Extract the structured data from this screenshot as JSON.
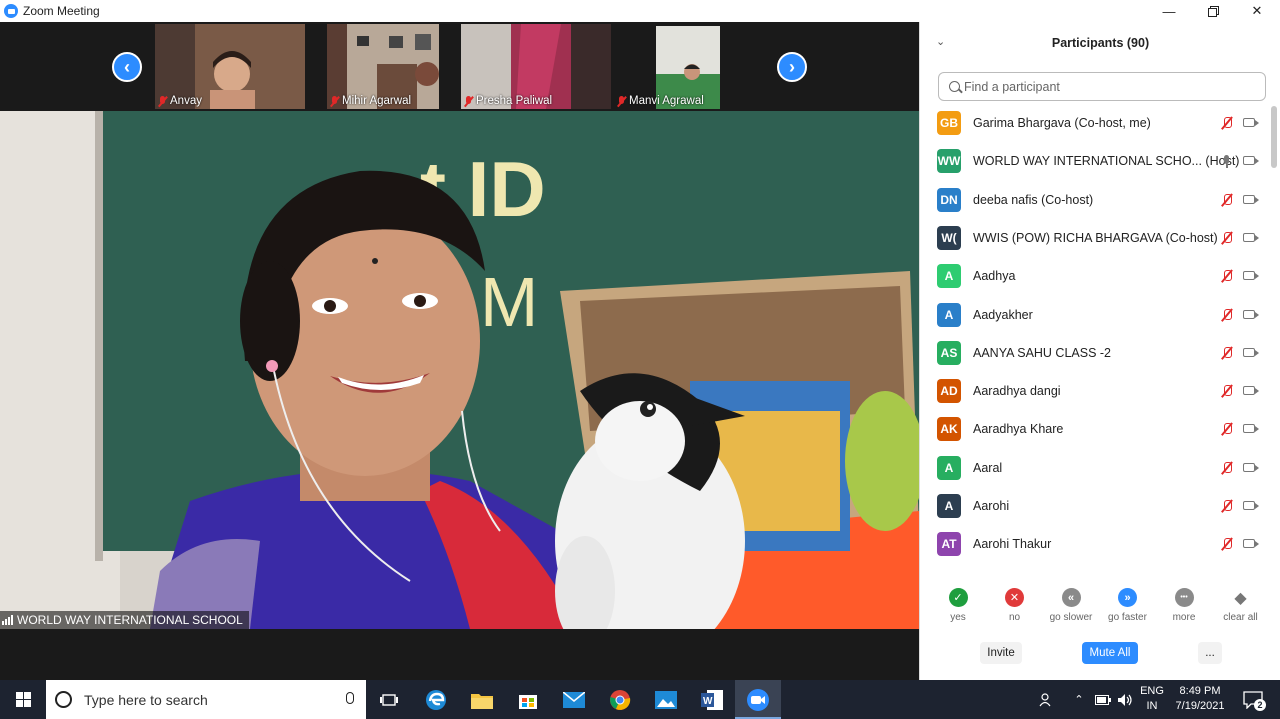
{
  "window": {
    "title": "Zoom Meeting",
    "controls": [
      "minimize",
      "restore",
      "close"
    ]
  },
  "thumbnails": [
    {
      "name": "Anvay",
      "muted": true
    },
    {
      "name": "Mihir Agarwal",
      "muted": true
    },
    {
      "name": "Presha  Paliwal",
      "muted": true
    },
    {
      "name": "Manvi Agrawal",
      "muted": true
    }
  ],
  "main_video": {
    "label": "WORLD WAY INTERNATIONAL SCHOOL"
  },
  "participants_panel": {
    "title": "Participants (90)",
    "search_placeholder": "Find a participant",
    "participants": [
      {
        "initials": "GB",
        "name": "Garima Bhargava (Co-host, me)",
        "color": "#f39c12",
        "muted": true
      },
      {
        "initials": "WW",
        "name": "WORLD WAY INTERNATIONAL SCHO... (Host)",
        "color": "#27a06b",
        "muted": false
      },
      {
        "initials": "DN",
        "name": "deeba nafis (Co-host)",
        "color": "#2a7fc9",
        "muted": true
      },
      {
        "initials": "W(",
        "name": "WWIS (POW) RICHA BHARGAVA (Co-host)",
        "color": "#2c3e50",
        "muted": true
      },
      {
        "initials": "A",
        "name": "Aadhya",
        "color": "#2ecc71",
        "muted": true
      },
      {
        "initials": "A",
        "name": "Aadyakher",
        "color": "#2a7fc9",
        "muted": true
      },
      {
        "initials": "AS",
        "name": "AANYA SAHU CLASS -2",
        "color": "#27ae60",
        "muted": true
      },
      {
        "initials": "AD",
        "name": "Aaradhya dangi",
        "color": "#d35400",
        "muted": true
      },
      {
        "initials": "AK",
        "name": "Aaradhya Khare",
        "color": "#d35400",
        "muted": true
      },
      {
        "initials": "A",
        "name": "Aaral",
        "color": "#27ae60",
        "muted": true
      },
      {
        "initials": "A",
        "name": "Aarohi",
        "color": "#2c3e50",
        "muted": true
      },
      {
        "initials": "AT",
        "name": "Aarohi Thakur",
        "color": "#8e44ad",
        "muted": true
      }
    ],
    "reactions": [
      {
        "label": "yes",
        "icon": "check-icon",
        "color": "#1e9e3e"
      },
      {
        "label": "no",
        "icon": "x-icon",
        "color": "#e03a3a"
      },
      {
        "label": "go slower",
        "icon": "rewind-icon",
        "color": "#8a8a8a"
      },
      {
        "label": "go faster",
        "icon": "fast-forward-icon",
        "color": "#2d8cff"
      },
      {
        "label": "more",
        "icon": "more-icon",
        "color": "#8a8a8a"
      },
      {
        "label": "clear all",
        "icon": "eraser-icon",
        "color": "#8a8a8a"
      }
    ],
    "buttons": {
      "invite": "Invite",
      "mute_all": "Mute All",
      "more": "..."
    }
  },
  "taskbar": {
    "search_placeholder": "Type here to search",
    "lang_line1": "ENG",
    "lang_line2": "IN",
    "time": "8:49 PM",
    "date": "7/19/2021",
    "notifications": "2"
  },
  "colors": {
    "accent": "#2d8cff",
    "muted_red": "#e02828",
    "taskbar": "#1d2330"
  }
}
